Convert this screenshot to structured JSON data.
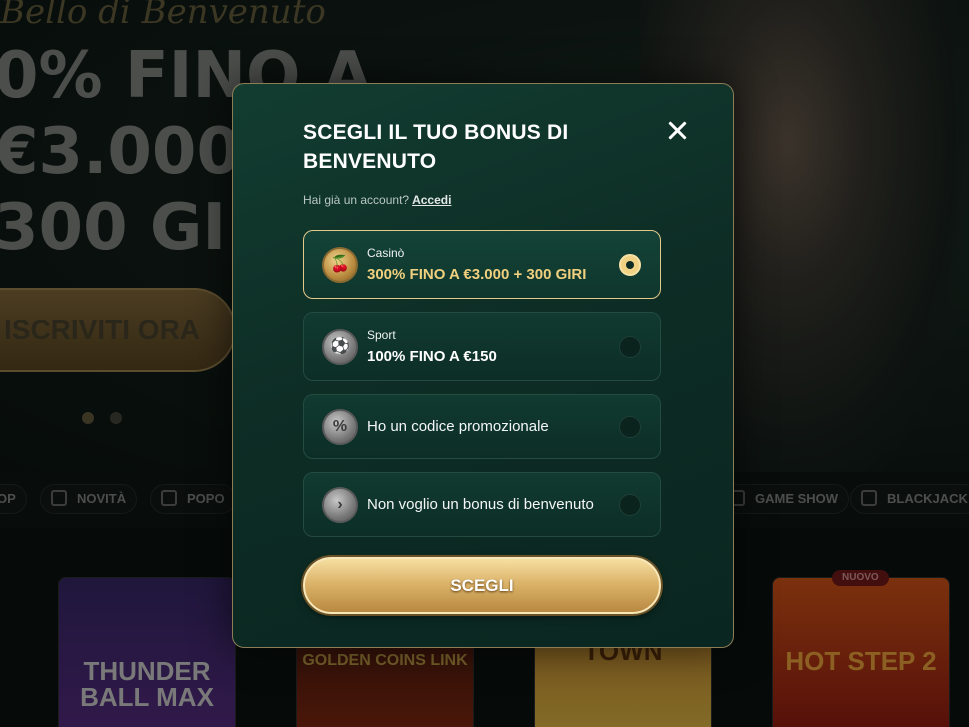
{
  "background": {
    "greeting": "Bello di Benvenuto",
    "headline_lines": [
      "0% FINO A",
      "€3.000",
      "300 GIRI"
    ],
    "cta_label": "ISCRIVITI ORA",
    "nav_items": [
      "OP",
      "NOVITÀ",
      "POPO",
      "GAME SHOW",
      "BLACKJACK"
    ],
    "games": [
      "THUNDER BALL MAX",
      "GOLDEN COINS LINK",
      "TOWN",
      "HOT STEP 2"
    ],
    "game_badge": "NUOVO"
  },
  "modal": {
    "title": "SCEGLI IL TUO BONUS DI BENVENUTO",
    "account_prompt": "Hai già un account?",
    "login_link": "Accedi",
    "options": [
      {
        "subtitle": "Casinò",
        "label": "300% FINO A €3.000 + 300 GIRI",
        "icon": "cherry-icon",
        "selected": true
      },
      {
        "subtitle": "Sport",
        "label": "100% FINO A €150",
        "icon": "soccer-ball-icon",
        "selected": false
      },
      {
        "label": "Ho un codice promozionale",
        "icon": "promo-ticket-icon",
        "selected": false
      },
      {
        "label": "Non voglio un bonus di benvenuto",
        "icon": "arrow-right-icon",
        "selected": false
      }
    ],
    "submit_label": "SCEGLI"
  },
  "colors": {
    "modal_bg": "#0d2d25",
    "accent_gold": "#f0d07e",
    "button_gold": "#dcb46a"
  }
}
